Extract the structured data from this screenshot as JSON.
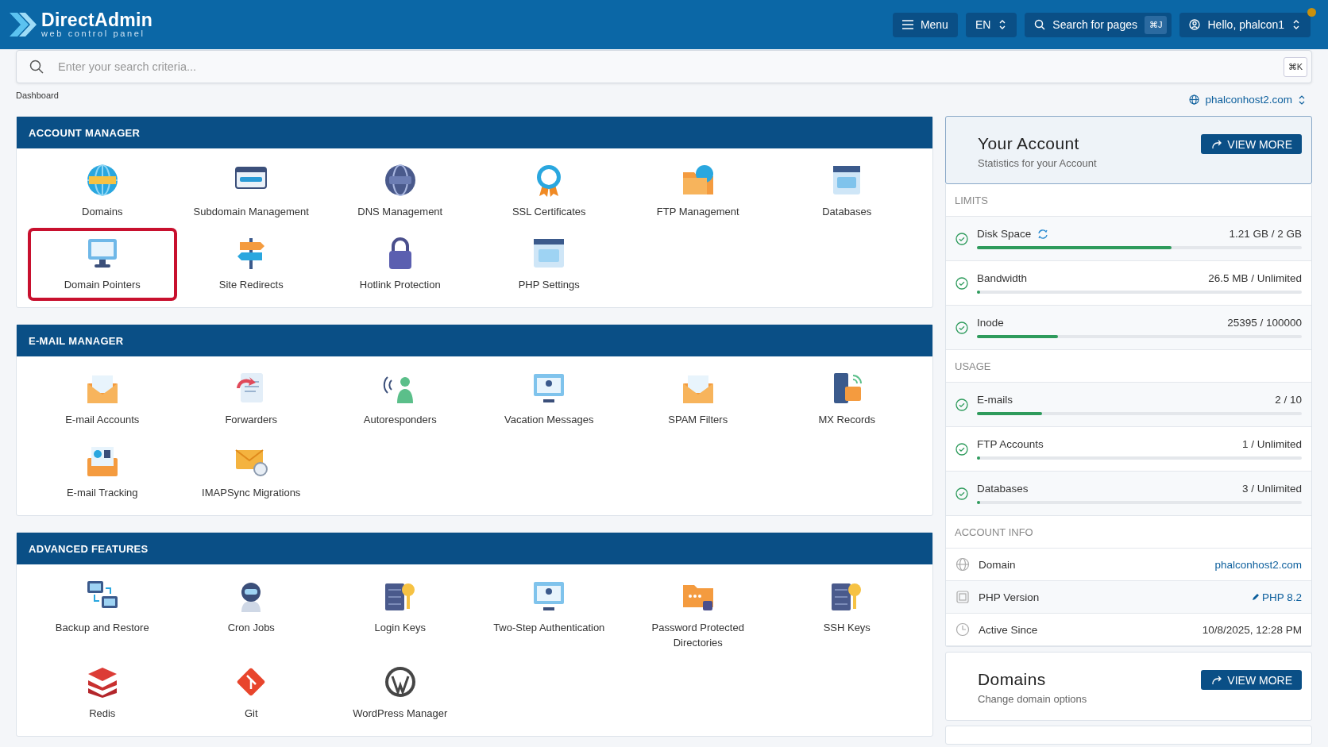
{
  "header": {
    "logo": {
      "name": "DirectAdmin",
      "tagline": "web control panel"
    },
    "menu_button": "Menu",
    "language": "EN",
    "page_search": {
      "label": "Search for pages",
      "shortcut": "⌘J"
    },
    "user_menu": "Hello, phalcon1"
  },
  "search": {
    "placeholder": "Enter your search criteria...",
    "shortcut": "⌘K"
  },
  "breadcrumb": "Dashboard",
  "domain_selector": "phalconhost2.com",
  "sections": [
    {
      "title": "ACCOUNT MANAGER",
      "items": [
        {
          "label": "Domains",
          "selected": false
        },
        {
          "label": "Subdomain Management",
          "selected": false
        },
        {
          "label": "DNS Management",
          "selected": false
        },
        {
          "label": "SSL Certificates",
          "selected": false
        },
        {
          "label": "FTP Management",
          "selected": false
        },
        {
          "label": "Databases",
          "selected": false
        },
        {
          "label": "Domain Pointers",
          "selected": true
        },
        {
          "label": "Site Redirects",
          "selected": false
        },
        {
          "label": "Hotlink Protection",
          "selected": false
        },
        {
          "label": "PHP Settings",
          "selected": false
        }
      ]
    },
    {
      "title": "E-MAIL MANAGER",
      "items": [
        {
          "label": "E-mail Accounts",
          "selected": false
        },
        {
          "label": "Forwarders",
          "selected": false
        },
        {
          "label": "Autoresponders",
          "selected": false
        },
        {
          "label": "Vacation Messages",
          "selected": false
        },
        {
          "label": "SPAM Filters",
          "selected": false
        },
        {
          "label": "MX Records",
          "selected": false
        },
        {
          "label": "E-mail Tracking",
          "selected": false
        },
        {
          "label": "IMAPSync Migrations",
          "selected": false
        }
      ]
    },
    {
      "title": "ADVANCED FEATURES",
      "items": [
        {
          "label": "Backup and Restore",
          "selected": false
        },
        {
          "label": "Cron Jobs",
          "selected": false
        },
        {
          "label": "Login Keys",
          "selected": false
        },
        {
          "label": "Two-Step Authentication",
          "selected": false
        },
        {
          "label": "Password Protected Directories",
          "selected": false
        },
        {
          "label": "SSH Keys",
          "selected": false
        },
        {
          "label": "Redis",
          "selected": false
        },
        {
          "label": "Git",
          "selected": false
        },
        {
          "label": "WordPress Manager",
          "selected": false
        }
      ]
    }
  ],
  "account": {
    "title": "Your Account",
    "subtitle": "Statistics for your Account",
    "button": "VIEW MORE",
    "groups": [
      {
        "heading": "LIMITS",
        "rows": [
          {
            "label": "Disk Space",
            "value": "1.21 GB / 2 GB",
            "level": 0.6,
            "refreshable": true
          },
          {
            "label": "Bandwidth",
            "value": "26.5 MB / Unlimited",
            "level": 0.005,
            "refreshable": false
          },
          {
            "label": "Inode",
            "value": "25395 / 100000",
            "level": 0.25,
            "refreshable": false
          }
        ]
      },
      {
        "heading": "USAGE",
        "rows": [
          {
            "label": "E-mails",
            "value": "2 / 10",
            "level": 0.2,
            "refreshable": false
          },
          {
            "label": "FTP Accounts",
            "value": "1 / Unlimited",
            "level": 0.005,
            "refreshable": false
          },
          {
            "label": "Databases",
            "value": "3 / Unlimited",
            "level": 0.005,
            "refreshable": false
          }
        ]
      }
    ],
    "info_heading": "ACCOUNT INFO",
    "info": [
      {
        "kind": "domain",
        "label": "Domain",
        "value": "phalconhost2.com"
      },
      {
        "kind": "version",
        "label": "PHP Version",
        "value": "PHP 8.2"
      },
      {
        "kind": "date",
        "label": "Active Since",
        "value": "10/8/2025, 12:28 PM"
      }
    ]
  },
  "cards": [
    {
      "title": "Domains",
      "subtitle": "Change domain options",
      "button": "VIEW MORE"
    }
  ]
}
